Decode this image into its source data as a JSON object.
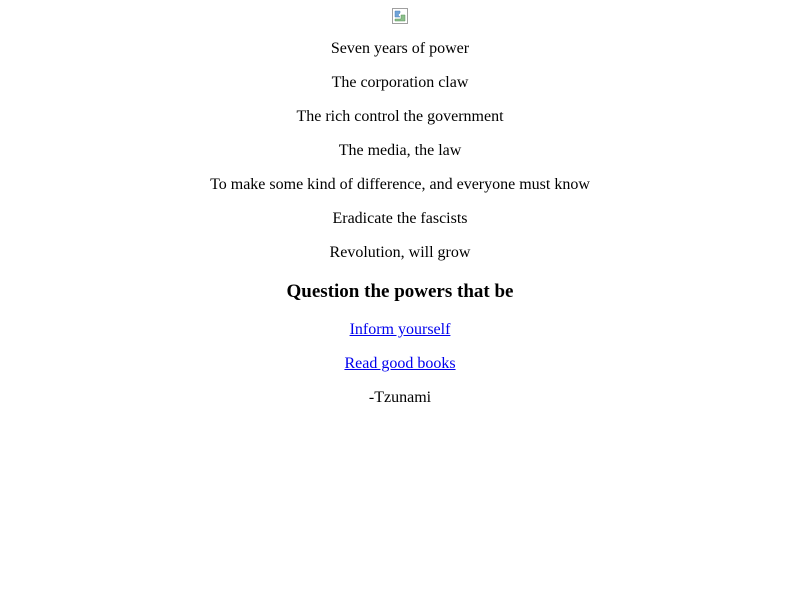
{
  "image": {
    "icon": "broken-image-icon"
  },
  "poem": {
    "lines": [
      "Seven years of power",
      "The corporation claw",
      "The rich control the government",
      "The media, the law",
      "To make some kind of difference, and everyone must know",
      "Eradicate the fascists",
      "Revolution, will grow"
    ],
    "heading": "Question the powers that be"
  },
  "links": {
    "inform": "Inform yourself",
    "books": "Read good books"
  },
  "signature": "-Tzunami",
  "colors": {
    "link": "#0000ee",
    "text": "#000000",
    "background": "#ffffff"
  }
}
